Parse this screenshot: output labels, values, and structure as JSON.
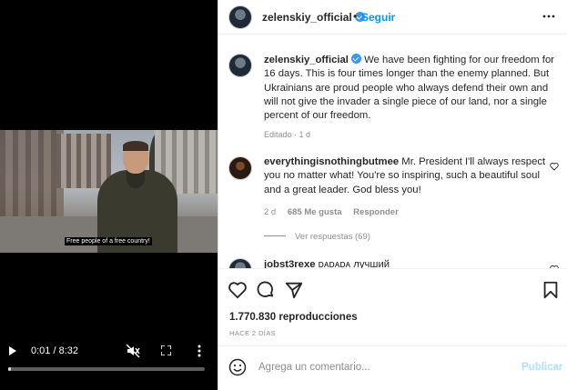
{
  "video": {
    "subtitle": "Free people of a free country!",
    "time": "0:01 / 8:32",
    "progress_fraction": 0.005,
    "icons": {
      "play": "play-icon",
      "mute": "volume-muted-icon",
      "fullscreen": "fullscreen-icon",
      "more": "vertical-dots-icon"
    }
  },
  "header": {
    "username": "zelenskiy_official",
    "separator": "•",
    "follow_label": "Seguir",
    "more_icon": "horizontal-dots-icon"
  },
  "caption": {
    "username": "zelenskiy_official",
    "text": "We have been fighting for our freedom for 16 days. This is four times longer than the enemy planned. But Ukrainians are proud people who always defend their own and will not give the invader a single piece of our land, nor a single percent of our freedom.",
    "meta": "Editado · 1 d"
  },
  "comments": [
    {
      "username": "everythingisnothingbutmee",
      "text": "Mr. President I'll always respect you no matter what! You're so inspiring, such a beautiful soul and a great leader. God bless you!",
      "age": "2 d",
      "likes": "685 Me gusta",
      "reply_label": "Responder",
      "view_replies": "Ver respuestas (69)"
    },
    {
      "username": "jobst3rexe",
      "text": "ᴅᴀᴅᴀᴅᴀ лучший"
    }
  ],
  "actions": {
    "icons": [
      "heart-icon",
      "comment-icon",
      "share-icon",
      "bookmark-icon"
    ],
    "views": "1.770.830 reproducciones",
    "posted": "HACE 2 DÍAS"
  },
  "add_comment": {
    "placeholder": "Agrega un comentario...",
    "publish_label": "Publicar"
  },
  "colors": {
    "accent": "#0095f6",
    "verified": "#3897f0",
    "muted_text": "#8e8e8e",
    "publish_disabled": "#b2dffc"
  }
}
